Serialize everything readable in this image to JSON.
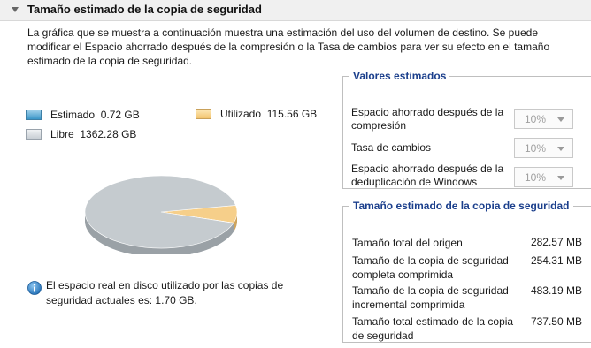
{
  "section": {
    "title": "Tamaño estimado de la copia de seguridad",
    "description": "La gráfica que se muestra a continuación muestra una estimación del uso del volumen de destino. Se puede modificar el Espacio ahorrado después de la compresión o la Tasa de cambios para ver su efecto en el tamaño estimado de la copia de seguridad."
  },
  "legend": {
    "estimated": {
      "label": "Estimado",
      "value": "0.72 GB"
    },
    "used": {
      "label": "Utilizado",
      "value": "115.56 GB"
    },
    "free": {
      "label": "Libre",
      "value": "1362.28 GB"
    }
  },
  "info": {
    "text": "El espacio real en disco utilizado por las copias de seguridad actuales es: 1.70 GB."
  },
  "estimated_values": {
    "title": "Valores estimados",
    "rows": [
      {
        "label_line1": "Espacio ahorrado después de la",
        "label_line2": "compresión",
        "value": "10%"
      },
      {
        "label_line1": "Tasa de cambios",
        "label_line2": "",
        "value": "10%"
      },
      {
        "label_line1": "Espacio ahorrado después de la",
        "label_line2": "deduplicación de Windows",
        "value": "10%"
      }
    ]
  },
  "estimated_size": {
    "title": "Tamaño estimado de la copia de seguridad",
    "rows": [
      {
        "label_line1": "Tamaño total del origen",
        "label_line2": "",
        "value": "282.57 MB"
      },
      {
        "label_line1": "Tamaño de la copia de seguridad",
        "label_line2": "completa comprimida",
        "value": "254.31 MB"
      },
      {
        "label_line1": "Tamaño de la copia de seguridad",
        "label_line2": "incremental comprimida",
        "value": "483.19 MB"
      },
      {
        "label_line1": "Tamaño total estimado de la copia",
        "label_line2": "de seguridad",
        "value": "737.50 MB"
      }
    ]
  },
  "pie": {
    "free_fraction": 0.9216,
    "used_fraction": 0.0782,
    "estimated_fraction": 0.0005
  },
  "colors": {
    "legend_title": "#1b3f8c",
    "pie_free": "#c5cbcf",
    "pie_used": "#f6cf8a",
    "pie_estimated": "#3a96c8"
  }
}
